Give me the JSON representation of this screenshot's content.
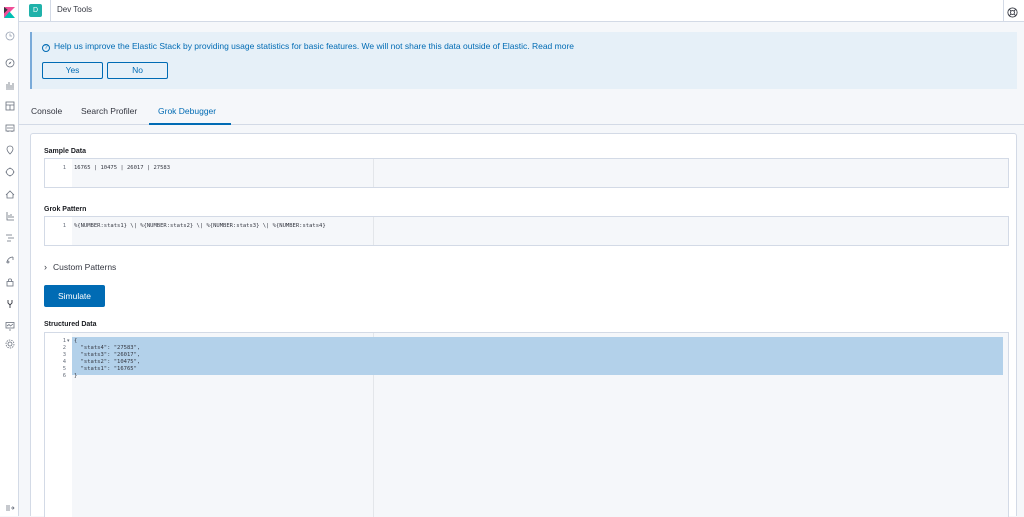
{
  "header": {
    "avatar_letter": "D",
    "title": "Dev Tools"
  },
  "nav": {
    "icons": [
      "clock-icon",
      "compass-icon",
      "visualize-icon",
      "dashboard-icon",
      "canvas-icon",
      "maps-icon",
      "ml-icon",
      "infrastructure-icon",
      "logs-icon",
      "apm-icon",
      "uptime-icon",
      "siem-icon",
      "dev-tools-icon",
      "monitoring-icon",
      "management-icon"
    ],
    "collapse_icon": "dock-icon"
  },
  "callout": {
    "text": "Help us improve the Elastic Stack by providing usage statistics for basic features. We will not share this data outside of Elastic. Read more",
    "yes_label": "Yes",
    "no_label": "No"
  },
  "tabs": [
    {
      "label": "Console"
    },
    {
      "label": "Search Profiler"
    },
    {
      "label": "Grok Debugger",
      "active": true
    }
  ],
  "grok": {
    "sample_label": "Sample Data",
    "sample_lines": [
      "16765 | 10475 | 26017 | 27583"
    ],
    "pattern_label": "Grok Pattern",
    "pattern_lines": [
      "%{NUMBER:stats1} \\| %{NUMBER:stats2} \\| %{NUMBER:stats3} \\| %{NUMBER:stats4}"
    ],
    "custom_patterns_label": "Custom Patterns",
    "simulate_label": "Simulate",
    "structured_label": "Structured Data",
    "structured_lines": [
      "{",
      "  \"stats4\": \"27583\",",
      "  \"stats3\": \"26017\",",
      "  \"stats2\": \"10475\",",
      "  \"stats1\": \"16765\"",
      "}"
    ]
  },
  "colors": {
    "accent": "#006bb4",
    "callout_bg": "#e6f0f8",
    "avatar": "#20b2aa",
    "selection": "#b3d1ea"
  }
}
